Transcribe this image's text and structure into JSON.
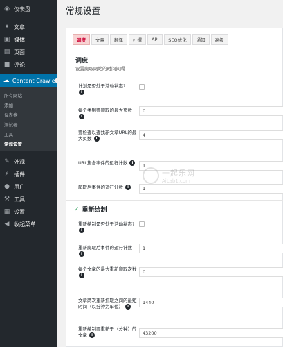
{
  "sidebar": {
    "items_top": [
      {
        "label": "仪表盘",
        "icon": "dashboard-icon"
      },
      {
        "label": "文章",
        "icon": "pin-icon"
      },
      {
        "label": "媒体",
        "icon": "media-icon"
      },
      {
        "label": "页面",
        "icon": "page-icon"
      },
      {
        "label": "评论",
        "icon": "comment-icon"
      }
    ],
    "active": {
      "label": "Content Crawler",
      "icon": "crawler-icon"
    },
    "submenu": [
      "所有网站",
      "添加",
      "仪表盘",
      "测试者",
      "工具",
      "常规设置"
    ],
    "items_bottom": [
      {
        "label": "外观",
        "icon": "brush-icon"
      },
      {
        "label": "插件",
        "icon": "plugin-icon"
      },
      {
        "label": "用户",
        "icon": "user-icon"
      },
      {
        "label": "工具",
        "icon": "wrench-icon"
      },
      {
        "label": "设置",
        "icon": "settings-icon"
      },
      {
        "label": "收起菜单",
        "icon": "collapse-icon"
      }
    ]
  },
  "header": {
    "title": "常规设置"
  },
  "tabs": [
    "调度",
    "文章",
    "翻译",
    "杜撰",
    "API",
    "SEO优化",
    "通知",
    "高级"
  ],
  "section": {
    "title": "调度",
    "desc": "设置爬取网站的时间间隔"
  },
  "fields": [
    {
      "label": "计划是否处于活动状态?",
      "type": "checkbox",
      "value": ""
    },
    {
      "label": "每个类别要爬取的最大页数",
      "type": "text",
      "value": "0"
    },
    {
      "label": "要检查以查找新文章URL的最大页数",
      "type": "text",
      "value": "4"
    },
    {
      "label": "URL集合事件的运行计数",
      "type": "text",
      "value": "1"
    },
    {
      "label": "爬取后事件的运行计数",
      "type": "text",
      "value": "1"
    }
  ],
  "subsection": {
    "title": "重新绘制"
  },
  "recrawl_fields": [
    {
      "label": "重新绘制是否处于活动状态?",
      "type": "checkbox",
      "value": ""
    },
    {
      "label": "重新爬取后事件的运行计数",
      "type": "text",
      "value": "1"
    },
    {
      "label": "每个文章的最大重新爬取次数",
      "type": "text",
      "value": "0"
    },
    {
      "label": "文章两次重新抓取之间的最短时间（以分钟为单位）",
      "type": "text",
      "value": "1440"
    },
    {
      "label": "重新绘制要重新于（分钟）的文章",
      "type": "text",
      "value": "43200"
    }
  ],
  "watermark": {
    "title": "一起乐网",
    "sub": "AiLab1.com"
  },
  "info_glyph": "i"
}
